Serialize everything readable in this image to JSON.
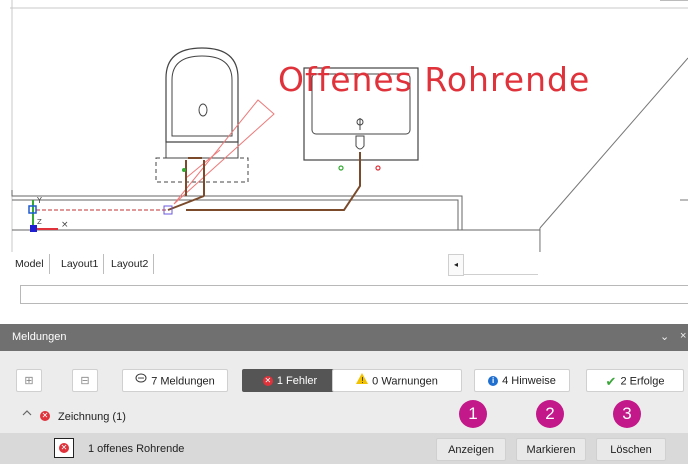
{
  "drawing": {
    "annotation_text": "Offenes Rohrende"
  },
  "layout_tabs": [
    "Model",
    "Layout1",
    "Layout2"
  ],
  "scroll_left_glyph": "◂",
  "panel": {
    "title": "Meldungen",
    "collapse_glyph": "⌄",
    "close_glyph": "×"
  },
  "toolbar": {
    "expand_all_glyph": "⊞",
    "collapse_all_glyph": "⊟",
    "meldungen": "7 Meldungen",
    "fehler": "1 Fehler",
    "warnungen": "0 Warnungen",
    "hinweise": "4 Hinweise",
    "erfolge": "2 Erfolge"
  },
  "group": {
    "label": "Zeichnung (1)",
    "chevron": "^"
  },
  "item": {
    "text": "1 offenes Rohrende"
  },
  "actions": {
    "anzeigen": "Anzeigen",
    "markieren": "Markieren",
    "loeschen": "Löschen"
  },
  "callouts": [
    "1",
    "2",
    "3"
  ],
  "colors": {
    "error_red": "#e0323a",
    "info_blue": "#1f6fd1",
    "success_green": "#3aa63a",
    "warning_yellow": "#f2c200",
    "callout_magenta": "#c2188a",
    "pipe_brown": "#7a4a2a"
  }
}
